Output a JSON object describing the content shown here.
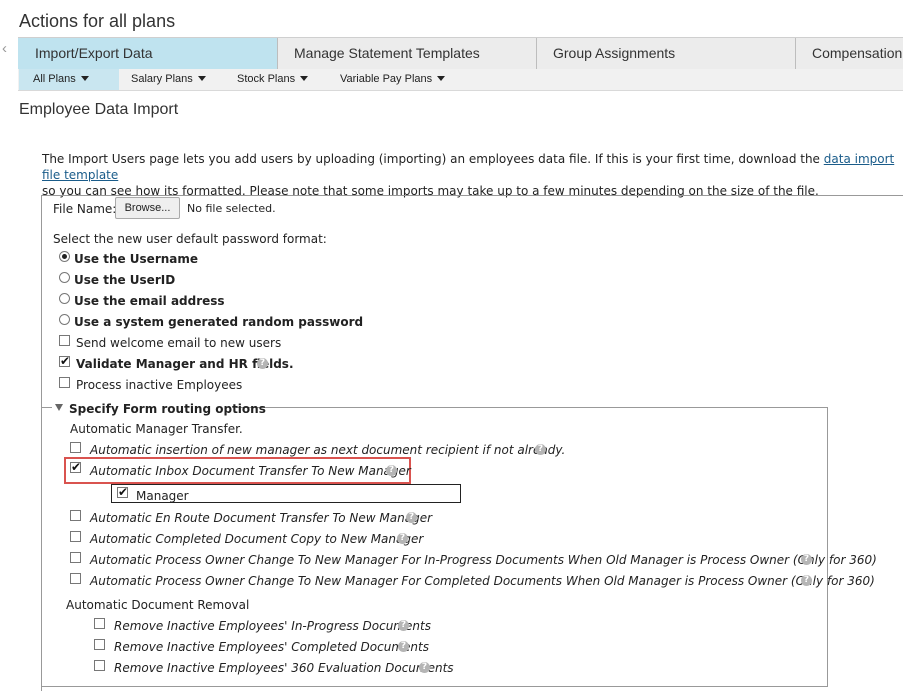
{
  "header": {
    "title": "Actions for all plans",
    "scroll_left": "‹"
  },
  "tabs": [
    {
      "label": "Import/Export Data",
      "active": true
    },
    {
      "label": "Manage Statement Templates",
      "active": false
    },
    {
      "label": "Group Assignments",
      "active": false
    },
    {
      "label": "Compensation F",
      "active": false
    }
  ],
  "subtabs": [
    {
      "label": "All Plans",
      "active": true
    },
    {
      "label": "Salary Plans",
      "active": false
    },
    {
      "label": "Stock Plans",
      "active": false
    },
    {
      "label": "Variable Pay Plans",
      "active": false
    }
  ],
  "section_title": "Employee Data Import",
  "intro": {
    "text_before_link": "The Import Users page lets you add users by uploading (importing) an employees data file. If this is your first time, download the ",
    "link": "data import file template",
    "text_after_link": "so you can see how its formatted. Please note that some imports may take up to a few minutes depending on the size of the file."
  },
  "file": {
    "label": "File Name:",
    "browse": "Browse...",
    "status": "No file selected."
  },
  "password": {
    "prompt": "Select the new user default password format:",
    "options": [
      {
        "label": "Use the Username",
        "selected": true
      },
      {
        "label": "Use the UserID",
        "selected": false
      },
      {
        "label": "Use the email address",
        "selected": false
      },
      {
        "label": "Use a system generated random password",
        "selected": false
      }
    ]
  },
  "options": [
    {
      "label": "Send welcome email to new users",
      "checked": false,
      "help": false
    },
    {
      "label": "Validate Manager and HR fields.",
      "checked": true,
      "help": true
    },
    {
      "label": "Process inactive Employees",
      "checked": false,
      "help": false
    }
  ],
  "routing": {
    "legend": "Specify Form routing options",
    "transfer_heading": "Automatic Manager Transfer.",
    "transfer_items": [
      {
        "label": "Automatic insertion of new manager as next document recipient if not already.",
        "checked": false
      },
      {
        "label": "Automatic Inbox Document Transfer To New Manager",
        "checked": true
      },
      {
        "label": "Automatic En Route Document Transfer To New Manager",
        "checked": false
      },
      {
        "label": "Automatic Completed Document Copy to New Manager",
        "checked": false
      },
      {
        "label": "Automatic Process Owner Change To New Manager For In-Progress Documents When Old Manager is Process Owner (Only for 360)",
        "checked": false
      },
      {
        "label": "Automatic Process Owner Change To New Manager For Completed Documents When Old Manager is Process Owner (Only for 360)",
        "checked": false
      }
    ],
    "manager_option": {
      "label": "Manager",
      "checked": true
    },
    "removal_heading": "Automatic Document Removal",
    "removal_items": [
      {
        "label": "Remove Inactive Employees' In-Progress Documents",
        "checked": false
      },
      {
        "label": "Remove Inactive Employees' Completed Documents",
        "checked": false
      },
      {
        "label": "Remove Inactive Employees' 360 Evaluation Documents",
        "checked": false
      }
    ]
  },
  "icons": {
    "help": "?",
    "check": "✔"
  },
  "colors": {
    "active_tab": "#bfe3ef",
    "highlight_border": "#d9534f",
    "link": "#1a5c8a"
  }
}
